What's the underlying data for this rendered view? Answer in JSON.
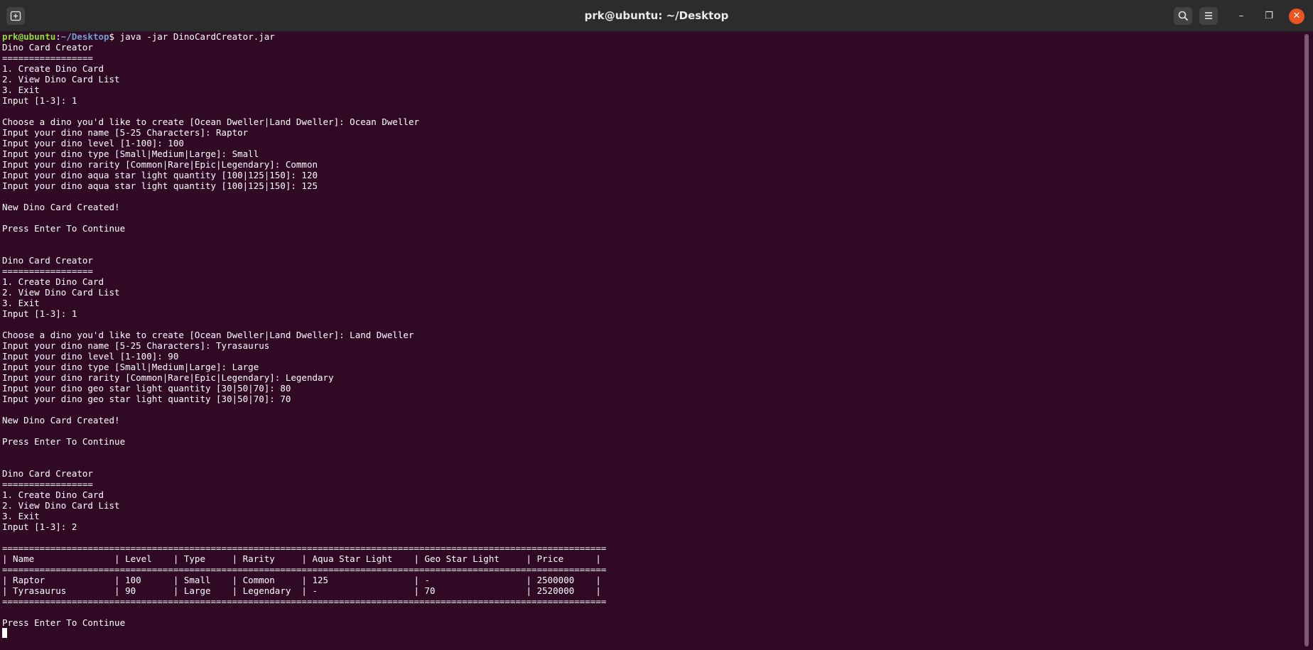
{
  "window": {
    "title": "prk@ubuntu: ~/Desktop",
    "close_glyph": "✕",
    "minimize_glyph": "–",
    "maximize_glyph": "❐"
  },
  "prompt": {
    "user_host": "prk@ubuntu",
    "colon": ":",
    "path": "~/Desktop",
    "symbol": "$ ",
    "command": "java -jar DinoCardCreator.jar"
  },
  "lines": [
    "Dino Card Creator",
    "=================",
    "1. Create Dino Card",
    "2. View Dino Card List",
    "3. Exit",
    "Input [1-3]: 1",
    "",
    "Choose a dino you'd like to create [Ocean Dweller|Land Dweller]: Ocean Dweller",
    "Input your dino name [5-25 Characters]: Raptor",
    "Input your dino level [1-100]: 100",
    "Input your dino type [Small|Medium|Large]: Small",
    "Input your dino rarity [Common|Rare|Epic|Legendary]: Common",
    "Input your dino aqua star light quantity [100|125|150]: 120",
    "Input your dino aqua star light quantity [100|125|150]: 125",
    "",
    "New Dino Card Created!",
    "",
    "Press Enter To Continue",
    "",
    "",
    "Dino Card Creator",
    "=================",
    "1. Create Dino Card",
    "2. View Dino Card List",
    "3. Exit",
    "Input [1-3]: 1",
    "",
    "Choose a dino you'd like to create [Ocean Dweller|Land Dweller]: Land Dweller",
    "Input your dino name [5-25 Characters]: Tyrasaurus",
    "Input your dino level [1-100]: 90",
    "Input your dino type [Small|Medium|Large]: Large",
    "Input your dino rarity [Common|Rare|Epic|Legendary]: Legendary",
    "Input your dino geo star light quantity [30|50|70]: 80",
    "Input your dino geo star light quantity [30|50|70]: 70",
    "",
    "New Dino Card Created!",
    "",
    "Press Enter To Continue",
    "",
    "",
    "Dino Card Creator",
    "=================",
    "1. Create Dino Card",
    "2. View Dino Card List",
    "3. Exit",
    "Input [1-3]: 2",
    "",
    "=================================================================================================================",
    "| Name               | Level    | Type     | Rarity     | Aqua Star Light    | Geo Star Light     | Price      |",
    "=================================================================================================================",
    "| Raptor             | 100      | Small    | Common     | 125                | -                  | 2500000    |",
    "| Tyrasaurus         | 90       | Large    | Legendary  | -                  | 70                 | 2520000    |",
    "=================================================================================================================",
    "",
    "Press Enter To Continue"
  ]
}
